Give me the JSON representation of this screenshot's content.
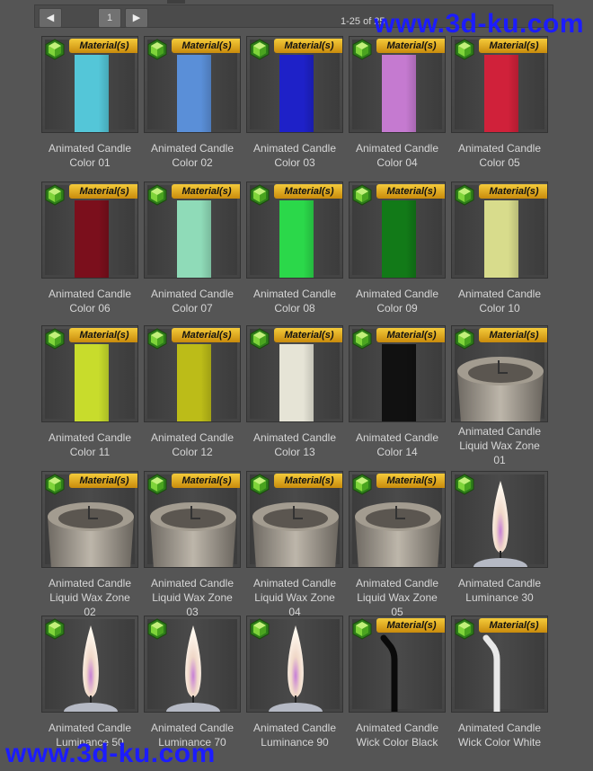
{
  "pager": {
    "prev_icon": "arrow-left-icon",
    "next_icon": "arrow-right-icon",
    "page": "1",
    "range": "1-25 of 25"
  },
  "watermark": "www.3d-ku.com",
  "badge_label": "Material(s)",
  "items": [
    {
      "line1": "Animated Candle",
      "line2": "Color 01",
      "kind": "bar",
      "color": "#54c6d8",
      "badge": true
    },
    {
      "line1": "Animated Candle",
      "line2": "Color 02",
      "kind": "bar",
      "color": "#5a8fd8",
      "badge": true
    },
    {
      "line1": "Animated Candle",
      "line2": "Color 03",
      "kind": "bar",
      "color": "#1e21c8",
      "badge": true
    },
    {
      "line1": "Animated Candle",
      "line2": "Color 04",
      "kind": "bar",
      "color": "#c57ad0",
      "badge": true
    },
    {
      "line1": "Animated Candle",
      "line2": "Color 05",
      "kind": "bar",
      "color": "#d0213a",
      "badge": true
    },
    {
      "line1": "Animated Candle",
      "line2": "Color 06",
      "kind": "bar",
      "color": "#7b0f1c",
      "badge": true
    },
    {
      "line1": "Animated Candle",
      "line2": "Color 07",
      "kind": "bar",
      "color": "#8fdbb8",
      "badge": true
    },
    {
      "line1": "Animated Candle",
      "line2": "Color 08",
      "kind": "bar",
      "color": "#2bd84a",
      "badge": true
    },
    {
      "line1": "Animated Candle",
      "line2": "Color 09",
      "kind": "bar",
      "color": "#127a18",
      "badge": true
    },
    {
      "line1": "Animated Candle",
      "line2": "Color 10",
      "kind": "bar",
      "color": "#d8dc8c",
      "badge": true
    },
    {
      "line1": "Animated Candle",
      "line2": "Color 11",
      "kind": "bar",
      "color": "#c8dc2c",
      "badge": true
    },
    {
      "line1": "Animated Candle",
      "line2": "Color 12",
      "kind": "bar",
      "color": "#bcbc18",
      "badge": true
    },
    {
      "line1": "Animated Candle",
      "line2": "Color 13",
      "kind": "bar",
      "color": "#e6e4d6",
      "badge": true
    },
    {
      "line1": "Animated Candle",
      "line2": "Color 14",
      "kind": "bar",
      "color": "#111111",
      "badge": true
    },
    {
      "line1": "Animated Candle",
      "line2": "Liquid Wax Zone",
      "line3": "01",
      "kind": "wax",
      "badge": true
    },
    {
      "line1": "Animated Candle",
      "line2": "Liquid Wax Zone",
      "line3": "02",
      "kind": "wax",
      "badge": true
    },
    {
      "line1": "Animated Candle",
      "line2": "Liquid Wax Zone",
      "line3": "03",
      "kind": "wax",
      "badge": true
    },
    {
      "line1": "Animated Candle",
      "line2": "Liquid Wax Zone",
      "line3": "04",
      "kind": "wax",
      "badge": true
    },
    {
      "line1": "Animated Candle",
      "line2": "Liquid Wax Zone",
      "line3": "05",
      "kind": "wax",
      "badge": true
    },
    {
      "line1": "Animated Candle",
      "line2": "Luminance 30",
      "kind": "flame",
      "badge": false
    },
    {
      "line1": "Animated Candle",
      "line2": "Luminance 50",
      "kind": "flame",
      "badge": false
    },
    {
      "line1": "Animated Candle",
      "line2": "Luminance 70",
      "kind": "flame",
      "badge": false
    },
    {
      "line1": "Animated Candle",
      "line2": "Luminance 90",
      "kind": "flame",
      "badge": false
    },
    {
      "line1": "Animated Candle",
      "line2": "Wick Color Black",
      "kind": "wick",
      "color": "#0a0a0a",
      "badge": true
    },
    {
      "line1": "Animated Candle",
      "line2": "Wick Color White",
      "kind": "wick",
      "color": "#e8e8e8",
      "badge": true
    }
  ]
}
